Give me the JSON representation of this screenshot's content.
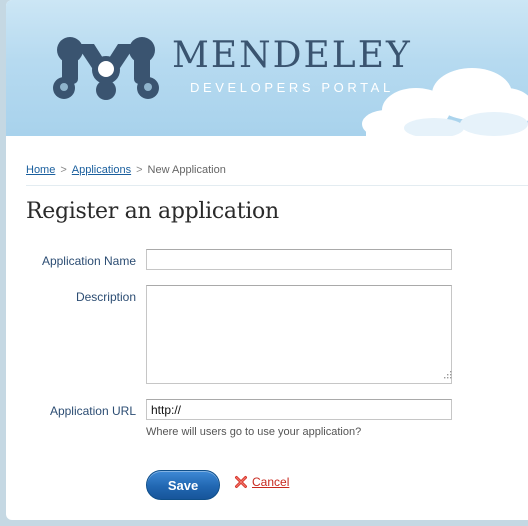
{
  "header": {
    "brand_name": "MENDELEY",
    "brand_tagline": "DEVELOPERS PORTAL"
  },
  "breadcrumb": {
    "items": [
      {
        "label": "Home"
      },
      {
        "label": "Applications"
      },
      {
        "label": "New Application"
      }
    ],
    "separator": ">"
  },
  "page": {
    "title": "Register an application"
  },
  "form": {
    "application_name": {
      "label": "Application Name",
      "value": ""
    },
    "description": {
      "label": "Description",
      "value": ""
    },
    "application_url": {
      "label": "Application URL",
      "value": "http://",
      "hint": "Where will users go to use your application?"
    },
    "save_label": "Save",
    "cancel_label": "Cancel"
  },
  "icons": {
    "logo": "mendeley-logo-icon",
    "cancel": "red-x-icon",
    "resize": "resize-grip-icon"
  },
  "colors": {
    "brand_text": "#3a5470",
    "link": "#1a5f9e",
    "save_button": "#2167b2",
    "cancel": "#c8281e"
  }
}
